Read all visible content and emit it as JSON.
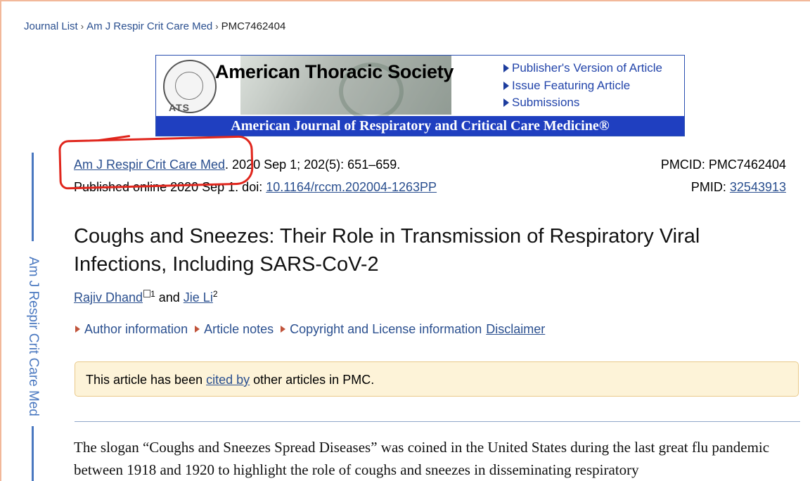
{
  "breadcrumb": {
    "items": [
      "Journal List",
      "Am J Respir Crit Care Med",
      "PMC7462404"
    ]
  },
  "banner": {
    "seal_text": "ATS",
    "society": "American Thoracic Society",
    "links": [
      "Publisher's Version of Article",
      "Issue Featuring Article",
      "Submissions"
    ],
    "journal": "American Journal of Respiratory and Critical Care Medicine®"
  },
  "side_label": "Am J Respir Crit Care Med",
  "citation": {
    "journal": "Am J Respir Crit Care Med",
    "rest": ". 2020 Sep 1; 202(5): 651–659.",
    "published_prefix": "Published online 2020 Sep 1. doi: ",
    "doi": "10.1164/rccm.202004-1263PP",
    "pmcid_label": "PMCID: PMC7462404",
    "pmid_label": "PMID: ",
    "pmid": "32543913"
  },
  "title": "Coughs and Sneezes: Their Role in Transmission of Respiratory Viral Infections, Including SARS-CoV-2",
  "authors": {
    "a1": "Rajiv Dhand",
    "a1_sup": "1",
    "and": " and ",
    "a2": "Jie Li",
    "a2_sup": "2"
  },
  "info_links": {
    "author_info": "Author information",
    "article_notes": "Article notes",
    "copyright": "Copyright and License information",
    "disclaimer": "Disclaimer"
  },
  "notice": {
    "before": "This article has been ",
    "link": "cited by",
    "after": " other articles in PMC."
  },
  "body_text": "The slogan “Coughs and Sneezes Spread Diseases” was coined in the United States during the last great flu pandemic between 1918 and 1920 to highlight the role of coughs and sneezes in disseminating respiratory"
}
